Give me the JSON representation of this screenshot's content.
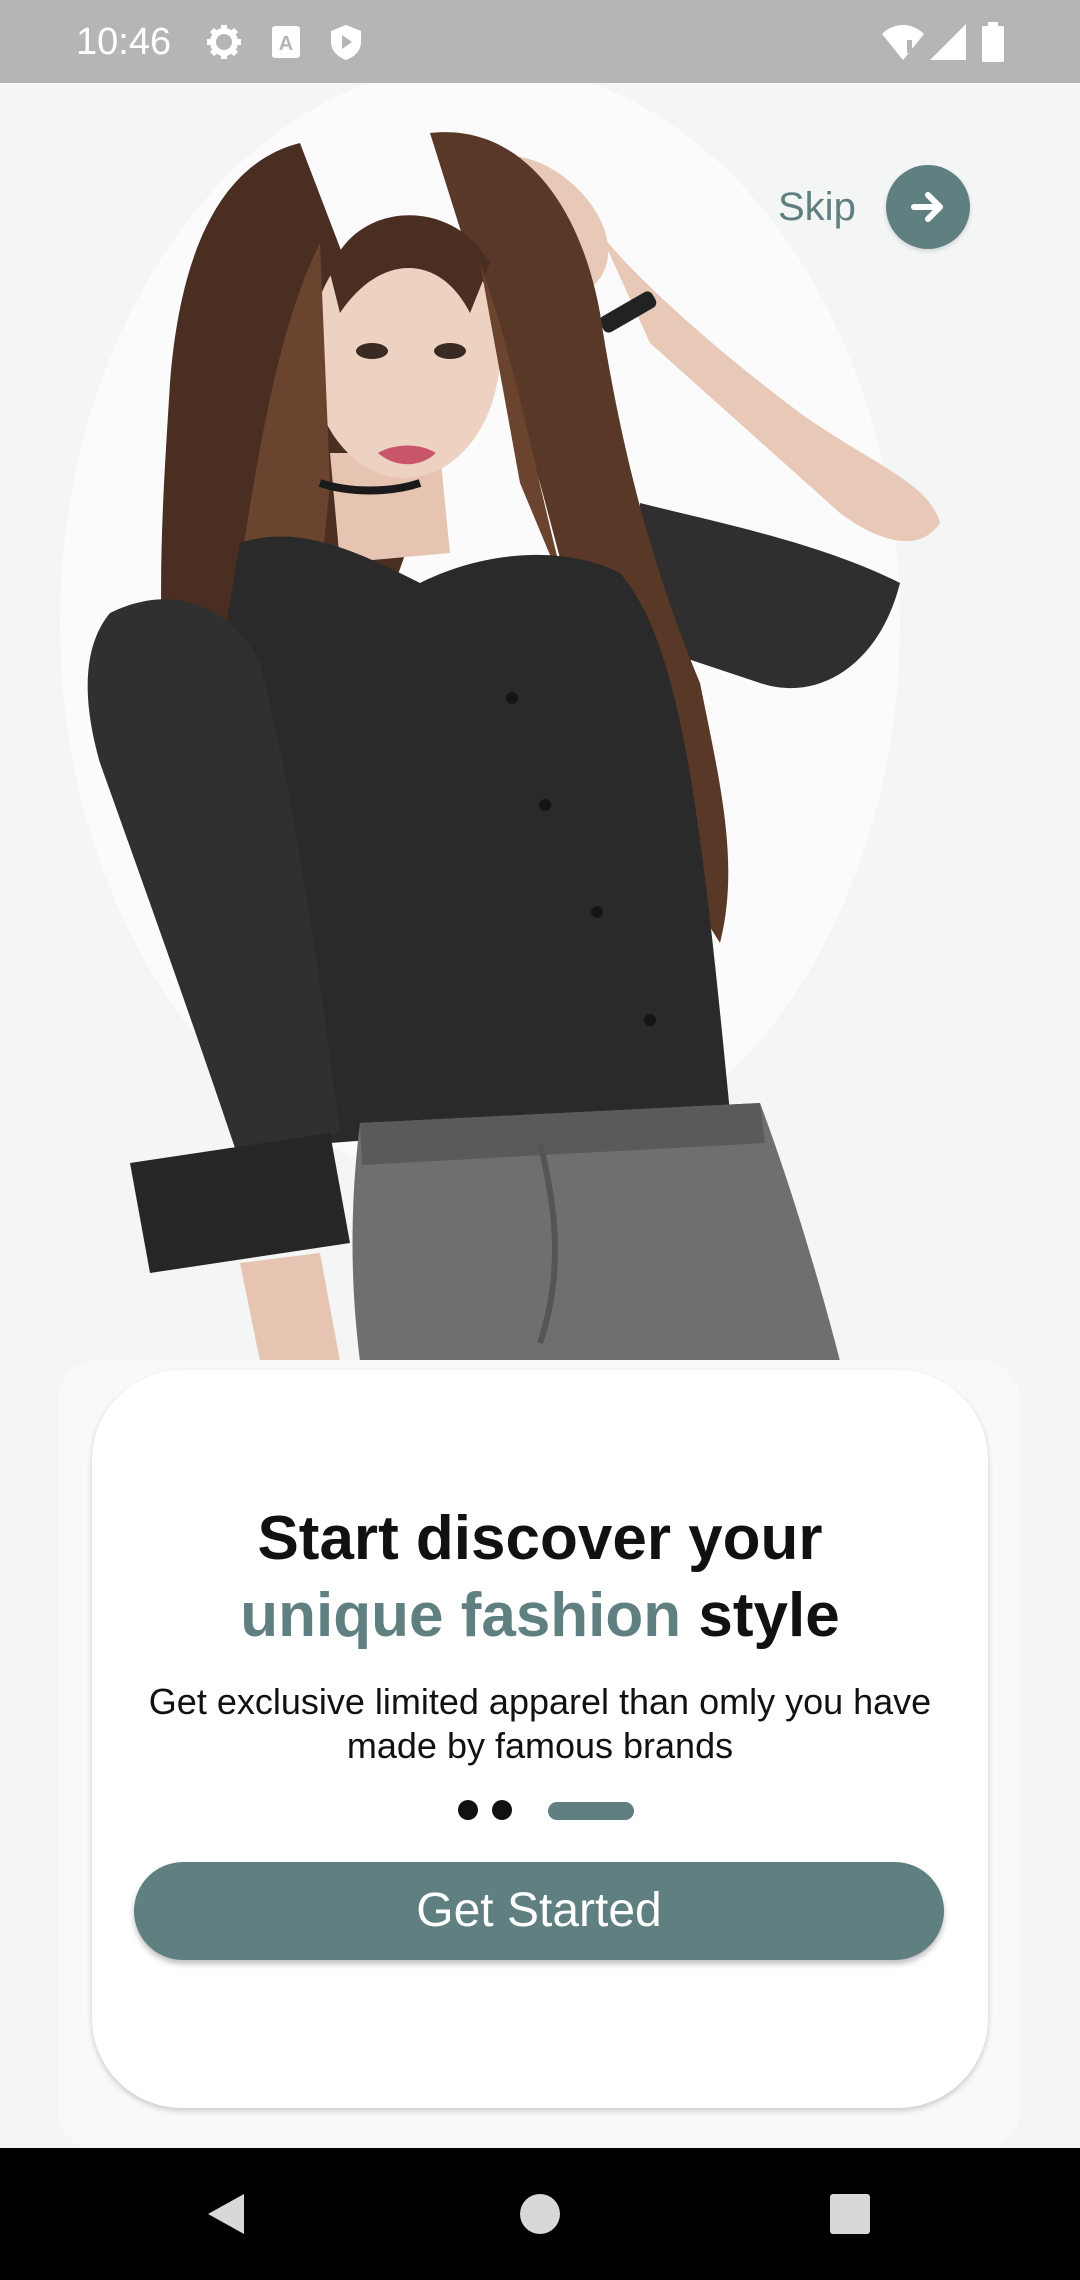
{
  "status_bar": {
    "time": "10:46"
  },
  "colors": {
    "accent": "#5f7f80",
    "text": "#111111",
    "card": "#ffffff",
    "background": "#f4f6f6"
  },
  "skip": {
    "label": "Skip",
    "icon": "arrow-right-icon"
  },
  "onboarding": {
    "headline_line1": "Start discover your",
    "headline_accent": "unique fashion",
    "headline_tail": " style",
    "subtitle_line1": "Get exclusive limited apparel than omly you have",
    "subtitle_line2": "made by famous brands",
    "page_indicator": {
      "total": 3,
      "active": 3
    },
    "cta_label": "Get Started"
  },
  "nav_bar": {
    "back": "back-triangle-icon",
    "home": "home-circle-icon",
    "recents": "recents-square-icon"
  }
}
